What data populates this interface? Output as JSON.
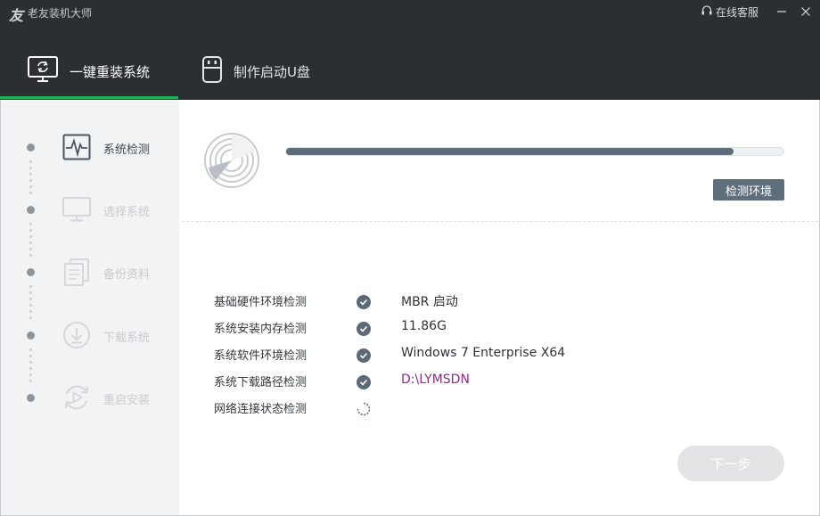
{
  "app": {
    "logo_char": "友",
    "title": "老友装机大师",
    "service_label": "在线客服",
    "minimize_icon": "minimize-icon",
    "close_icon": "close-icon"
  },
  "tabs": [
    {
      "label": "一键重装系统",
      "icon": "monitor-refresh-icon",
      "active": true
    },
    {
      "label": "制作启动U盘",
      "icon": "usb-drive-icon",
      "active": false
    }
  ],
  "sidebar": {
    "steps": [
      {
        "label": "系统检测",
        "icon": "pulse-monitor-icon",
        "active": true
      },
      {
        "label": "选择系统",
        "icon": "monitor-icon",
        "active": false
      },
      {
        "label": "备份资料",
        "icon": "documents-icon",
        "active": false
      },
      {
        "label": "下载系统",
        "icon": "download-icon",
        "active": false
      },
      {
        "label": "重启安装",
        "icon": "restart-icon",
        "active": false
      }
    ]
  },
  "detection": {
    "progress_percent": 90,
    "status_button": "检测环境",
    "items": [
      {
        "label": "基础硬件环境检测",
        "status": "done",
        "value": "MBR 启动"
      },
      {
        "label": "系统安装内存检测",
        "status": "done",
        "value": "11.86G"
      },
      {
        "label": "系统软件环境检测",
        "status": "done",
        "value": "Windows 7 Enterprise X64"
      },
      {
        "label": "系统下载路径检测",
        "status": "done",
        "value": "D:\\LYMSDN"
      },
      {
        "label": "网络连接状态检测",
        "status": "loading",
        "value": ""
      }
    ]
  },
  "footer": {
    "next_label": "下一步"
  },
  "colors": {
    "header_bg": "#2b2f33",
    "accent_green": "#1fb15a",
    "progress_fill": "#5d6d7c",
    "path_purple": "#8a2d86",
    "next_button_disabled": "#e1e3e5"
  }
}
